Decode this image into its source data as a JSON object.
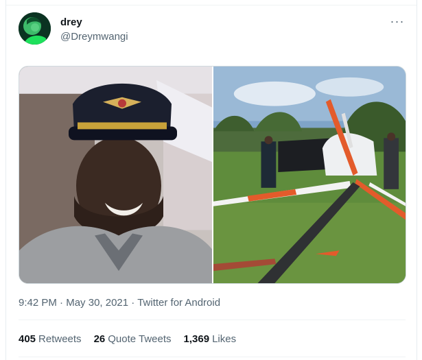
{
  "tweet": {
    "display_name": "drey",
    "handle": "@Dreymwangi",
    "more_icon": "more-horizontal-icon",
    "time": "9:42 PM",
    "separator": " · ",
    "date": "May 30, 2021",
    "source": "Twitter for Android",
    "media": [
      {
        "subject": "man in pilot cap"
      },
      {
        "subject": "crashed helicopter in field"
      }
    ]
  },
  "stats": {
    "retweets_count": "405",
    "retweets_label": "Retweets",
    "quotes_count": "26",
    "quotes_label": "Quote Tweets",
    "likes_count": "1,369",
    "likes_label": "Likes"
  },
  "colors": {
    "text_primary": "#0f1419",
    "text_secondary": "#536471",
    "border": "#cfd9de",
    "divider": "#eff3f4"
  }
}
